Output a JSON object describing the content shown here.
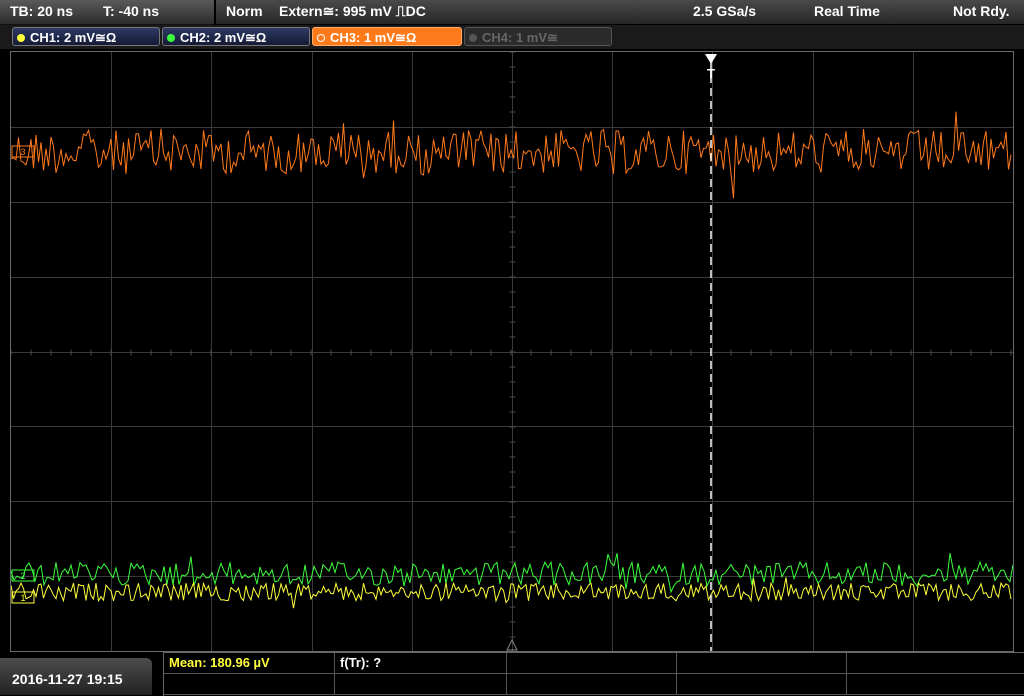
{
  "header": {
    "timebase": "TB: 20 ns",
    "trigger_offset": "T: -40 ns",
    "trigger_mode": "Norm",
    "trigger_source": "Extern≅: 995 mV ⎍DC",
    "sample_rate": "2.5 GSa/s",
    "acq_mode": "Real Time",
    "status": "Not Rdy."
  },
  "channels": [
    {
      "label": "CH1: 2 mV≅Ω",
      "color": "#ffff3c",
      "state": "active"
    },
    {
      "label": "CH2: 2 mV≅Ω",
      "color": "#3cff3c",
      "state": "active"
    },
    {
      "label": "CH3: 1 mV≅Ω",
      "color": "#ff7a1a",
      "state": "selected"
    },
    {
      "label": "CH4: 1 mV≅",
      "color": "#666666",
      "state": "off"
    }
  ],
  "markers": {
    "trigger": "T",
    "ch3_marker": "3",
    "ch2_marker": "2",
    "ch1_marker": "1"
  },
  "measurements": {
    "mean": "Mean: 180.96 µV",
    "freq": "f(Tr): ?"
  },
  "footer": {
    "datetime": "2016-11-27 19:15"
  },
  "colors": {
    "ch1": "#ffff3c",
    "ch2": "#3cff3c",
    "ch3": "#ff7a1a",
    "grid": "#3a3a3a",
    "mean_text": "#ffff3c"
  }
}
